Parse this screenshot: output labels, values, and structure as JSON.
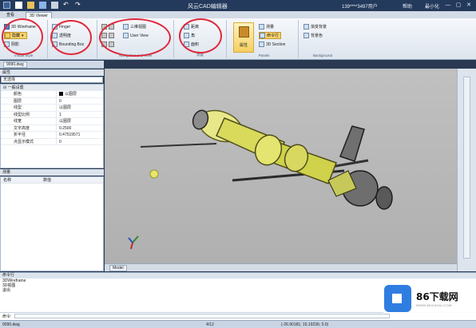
{
  "window": {
    "title": "风云CAD编辑器",
    "user": "139****3497用户",
    "help": "帮助",
    "minimize_label": "最小化",
    "btn_min": "—",
    "btn_max": "▢",
    "btn_close": "✕"
  },
  "tabs": [
    "查看",
    "3D Viewer"
  ],
  "ribbon": {
    "group1": {
      "title": "Visual Style",
      "items": [
        "3D Wireframe",
        "隐藏",
        "阴影"
      ]
    },
    "group2": {
      "title": "",
      "items": [
        "Finger",
        "透明度",
        "Bounding Box"
      ]
    },
    "group3": {
      "title": "Navigation and View",
      "items": [
        "三维视图",
        "User View"
      ]
    },
    "group4": {
      "title": "测量",
      "items": [
        "距离",
        "角",
        "面积"
      ]
    },
    "group5": {
      "title": "Panels",
      "big": "属性",
      "items": [
        "测量",
        "命令行",
        "3D Section"
      ]
    },
    "group6": {
      "title": "Background",
      "items": [
        "渐变背景",
        "背景色"
      ]
    }
  },
  "left": {
    "doc_tab": "9090.dwg",
    "panel_title": "属性",
    "selector": "无选择",
    "category": "一般设置",
    "props": [
      {
        "k": "颜色",
        "v": "以图层",
        "swatch": true
      },
      {
        "k": "图层",
        "v": "0"
      },
      {
        "k": "线型",
        "v": "以图层"
      },
      {
        "k": "线型比例",
        "v": "1"
      },
      {
        "k": "线宽",
        "v": "以图层"
      },
      {
        "k": "文字高度",
        "v": "0.2500"
      },
      {
        "k": "折半径",
        "v": "0.47519571"
      },
      {
        "k": "点显示模式",
        "v": "0"
      }
    ],
    "mid_title": "测量",
    "list_headers": [
      "名称",
      "数值"
    ]
  },
  "viewport": {
    "bottom_tab": "Model"
  },
  "command": {
    "title": "命令行",
    "lines": [
      "3DWireframe",
      "3D视图",
      "退出"
    ],
    "prompt": "命令:"
  },
  "status": {
    "file": "9090.dwg",
    "page": "4/12",
    "coords": "(-26.90181; 15.19236; 0.0)"
  },
  "watermark": {
    "brand": "86下载网",
    "url": "WWW.86XIAZAI.COM"
  }
}
